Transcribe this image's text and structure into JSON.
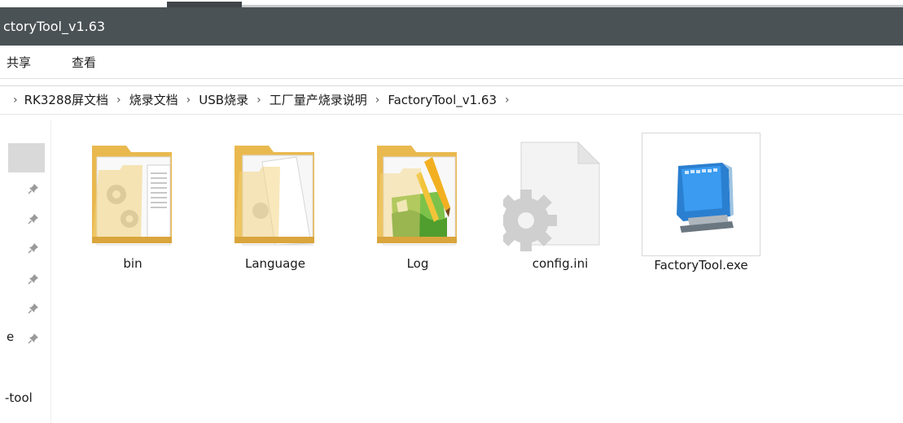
{
  "window": {
    "title": "ctoryTool_v1.63"
  },
  "ribbon": {
    "tabs": [
      "共享",
      "查看"
    ]
  },
  "breadcrumb": [
    "RK3288屏文档",
    "烧录文档",
    "USB烧录",
    "工厂量产烧录说明",
    "FactoryTool_v1.63"
  ],
  "nav": {
    "labels": [
      "e",
      "-tool"
    ]
  },
  "files": [
    {
      "name": "bin",
      "icon": "folder-gears-icon"
    },
    {
      "name": "Language",
      "icon": "folder-documents-icon"
    },
    {
      "name": "Log",
      "icon": "folder-images-icon"
    },
    {
      "name": "config.ini",
      "icon": "config-file-icon"
    },
    {
      "name": "FactoryTool.exe",
      "icon": "app-monitor-icon"
    }
  ]
}
